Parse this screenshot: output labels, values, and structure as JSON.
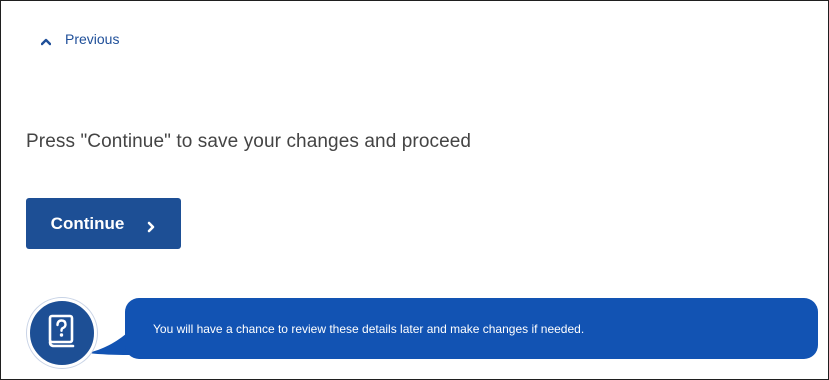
{
  "navigation": {
    "previous_label": "Previous",
    "previous_icon": "chevron-up-icon"
  },
  "main": {
    "instruction": "Press \"Continue\" to save your changes and proceed",
    "continue_label": "Continue",
    "continue_icon": "chevron-right-icon"
  },
  "help": {
    "icon": "question-book-icon",
    "tooltip_text": "You will have a chance to review these details later and make changes if needed."
  },
  "colors": {
    "primary": "#1d4f95",
    "tooltip_bg": "#1253b3",
    "link": "#1f4f99",
    "text": "#444444"
  }
}
